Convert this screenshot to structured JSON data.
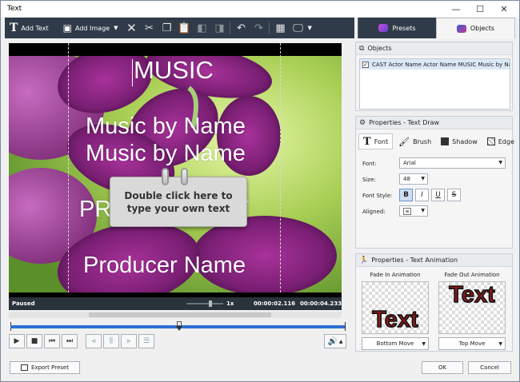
{
  "window": {
    "title": "Text",
    "min_icon": "minimize-icon",
    "max_icon": "maximize-icon",
    "close_icon": "close-icon"
  },
  "toolbar": {
    "add_text": "Add Text",
    "add_image": "Add Image",
    "icons": [
      "delete-icon",
      "cut-icon",
      "copy-icon",
      "paste-icon",
      "send-backward-icon",
      "bring-forward-icon",
      "undo-icon",
      "redo-icon",
      "grid-icon",
      "display-icon"
    ]
  },
  "tabs": {
    "presets": "Presets",
    "objects": "Objects"
  },
  "preview": {
    "texts": {
      "music": "MUSIC",
      "music_by_1": "Music by Name",
      "music_by_2": "Music by Name",
      "produced_by": "PRODUCED BY",
      "producer": "Producer Name"
    },
    "note": {
      "line1": "Double click here to",
      "line2": "type your own text"
    }
  },
  "status": {
    "state": "Paused",
    "speed": "1x",
    "current_time": "00:00:02.116",
    "total_time": "00:00:04.233"
  },
  "objects_panel": {
    "title": "Objects",
    "rows": [
      {
        "checked": true,
        "text": "CAST  Actor Name Actor Name  MUSIC  Music by Na..."
      }
    ]
  },
  "text_draw": {
    "title": "Properties - Text Draw",
    "tabs": {
      "font": "Font",
      "brush": "Brush",
      "shadow": "Shadow",
      "edge": "Edge"
    },
    "font_label": "Font:",
    "font_value": "Arial",
    "size_label": "Size:",
    "size_value": "48",
    "style_label": "Font Style:",
    "style_buttons": {
      "bold": "B",
      "italic": "I",
      "underline": "U",
      "strike": "S"
    },
    "aligned_label": "Aligned:"
  },
  "text_animation": {
    "title": "Properties - Text Animation",
    "fade_in_label": "Fade In Animation",
    "fade_out_label": "Fade Out Animation",
    "preview_text_in": "Text",
    "preview_text_out": "Text",
    "fade_in_value": "Bottom Move",
    "fade_out_value": "Top Move"
  },
  "footer": {
    "export": "Export Preset",
    "ok": "OK",
    "cancel": "Cancel"
  }
}
